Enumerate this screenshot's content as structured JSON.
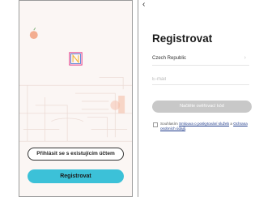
{
  "welcome_screen": {
    "login_button_label": "Přihlásit se s existujícím účtem",
    "register_button_label": "Registrovat"
  },
  "register_screen": {
    "back_icon": "chevron-left-icon",
    "title": "Registrovat",
    "country_value": "Czech Republic",
    "country_icon": "chevron-right-icon",
    "email_placeholder": "E-mail",
    "get_code_button_label": "Načtěte ověřovací kód",
    "consent_prefix": "Souhlasím",
    "terms_link": "Smlouva o poskytování služeb",
    "consent_and": "a",
    "privacy_link": "Ochrana osobních údajů",
    "consent_suffix": "."
  },
  "colors": {
    "accent": "#3cc1d8",
    "disabled_button": "#c8c8c8",
    "link": "#1e3a8a"
  }
}
